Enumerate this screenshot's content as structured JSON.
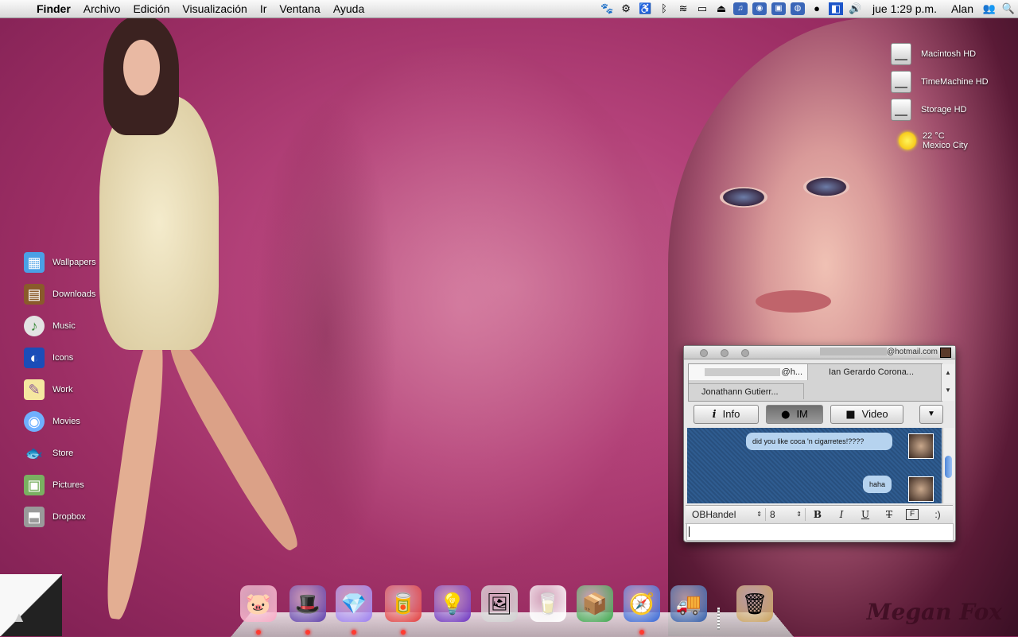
{
  "menubar": {
    "menus": [
      "Finder",
      "Archivo",
      "Edición",
      "Visualización",
      "Ir",
      "Ventana",
      "Ayuda"
    ],
    "clock": "jue 1:29 p.m.",
    "user": "Alan"
  },
  "desktop_right": {
    "drives": [
      {
        "label": "Macintosh HD"
      },
      {
        "label": "TimeMachine HD"
      },
      {
        "label": "Storage HD"
      }
    ],
    "weather": {
      "temp": "22 °C",
      "city": "Mexico City"
    }
  },
  "desktop_left": [
    {
      "label": "Wallpapers",
      "icon": "picture-frame-icon",
      "color": "#4aa0e6"
    },
    {
      "label": "Downloads",
      "icon": "box-icon",
      "color": "#8a5a2b"
    },
    {
      "label": "Music",
      "icon": "cd-icon",
      "color": "#d8d8d8"
    },
    {
      "label": "Icons",
      "icon": "pepsi-can-icon",
      "color": "#1b4db8"
    },
    {
      "label": "Work",
      "icon": "note-icon",
      "color": "#f5e7a0"
    },
    {
      "label": "Movies",
      "icon": "dvd-icon",
      "color": "#6fb0ff"
    },
    {
      "label": "Store",
      "icon": "goldfish-icon",
      "color": "#ff8a1a"
    },
    {
      "label": "Pictures",
      "icon": "photo-icon",
      "color": "#7ab061"
    },
    {
      "label": "Dropbox",
      "icon": "dropbox-icon",
      "color": "#9a9a9a"
    }
  ],
  "wallpaper": {
    "signature": "Megan Fox"
  },
  "chat": {
    "title_suffix": "@hotmail.com",
    "tabs": [
      "@h...",
      "Ian Gerardo Corona...",
      "Jonathann Gutierr..."
    ],
    "buttons": {
      "info": "Info",
      "im": "IM",
      "video": "Video"
    },
    "messages": [
      "did you like coca 'n cigarretes!????",
      "haha"
    ],
    "format": {
      "font": "OBHandel",
      "size": "8",
      "bold": "B",
      "italic": "I",
      "underline": "U",
      "strike": "T",
      "frame": "F",
      "smiley": ":)"
    }
  },
  "dock": [
    {
      "name": "dock-pig-icon",
      "glyph": "🐷",
      "color": "#f7a9c4"
    },
    {
      "name": "dock-magic-hat-icon",
      "glyph": "🎩",
      "color": "#5b3aa8"
    },
    {
      "name": "dock-messenger-gem-icon",
      "glyph": "💎",
      "color": "#9a7cf0"
    },
    {
      "name": "dock-soda-can-icon",
      "glyph": "🥫",
      "color": "#e23a3a"
    },
    {
      "name": "dock-lightbulb-icon",
      "glyph": "💡",
      "color": "#6a2fbf"
    },
    {
      "name": "dock-stamp-icon",
      "glyph": "🖼",
      "color": "#cfcfcf"
    },
    {
      "name": "dock-milk-carton-icon",
      "glyph": "🥛",
      "color": "#ffffff"
    },
    {
      "name": "dock-soda-box-icon",
      "glyph": "📦",
      "color": "#3aa64a"
    },
    {
      "name": "dock-safari-icon",
      "glyph": "🧭",
      "color": "#3264d6"
    },
    {
      "name": "dock-delivery-truck-icon",
      "glyph": "🚚",
      "color": "#2f5aa7"
    },
    {
      "name": "dock-trash-icon",
      "glyph": "🗑",
      "color": "#c9a05a"
    }
  ]
}
